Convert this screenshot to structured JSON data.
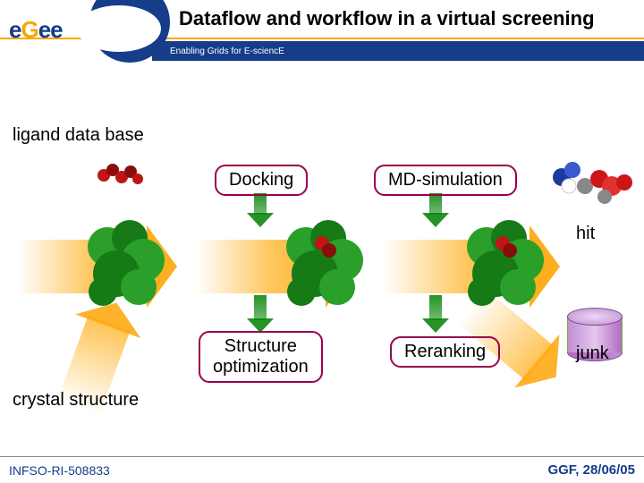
{
  "header": {
    "title": "Dataflow and workflow in a virtual screening",
    "tagline": "Enabling Grids for E-sciencE",
    "logo": {
      "letters": [
        "e",
        "G",
        "e",
        "e"
      ]
    }
  },
  "labels": {
    "ligand": "ligand data base",
    "crystal": "crystal structure",
    "hit": "hit",
    "junk": "junk"
  },
  "nodes": {
    "docking": "Docking",
    "mdsim": "MD-simulation",
    "structopt": "Structure\noptimization",
    "rerank": "Reranking"
  },
  "footer": {
    "left": "INFSO-RI-508833",
    "right": "GGF, 28/06/05"
  }
}
